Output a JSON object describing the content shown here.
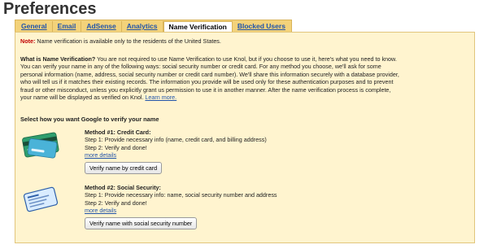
{
  "page": {
    "title": "Preferences"
  },
  "tabs": [
    {
      "label": "General",
      "active": false
    },
    {
      "label": "Email",
      "active": false
    },
    {
      "label": "AdSense",
      "active": false
    },
    {
      "label": "Analytics",
      "active": false
    },
    {
      "label": "Name Verification",
      "active": true
    },
    {
      "label": "Blocked Users",
      "active": false
    }
  ],
  "note": {
    "label": "Note:",
    "text": "Name verification is available only to the residents of the United States."
  },
  "about": {
    "heading": "What is Name Verification?",
    "line1": "You are not required to use Name Verification to use Knol, but if you choose to use it, here's what you need to know.",
    "line2": "You can verify your name in any of the following ways: social security number or credit card. For any method you choose, we'll ask for some",
    "line3": "personal information (name, address, social security number or credit card number). We'll share this information securely with a database provider,",
    "line4": "who will tell us if it matches their existing records. The information you provide will be used only for these authentication purposes and to prevent",
    "line5": "fraud or other misconduct, unless you explicitly grant us permission to use it in another manner. After the name verification process is complete,",
    "line6": "your name will be displayed as verified on Knol.",
    "learn_more": "Learn more."
  },
  "select_label": "Select how you want Google to verify your name",
  "methods": [
    {
      "title": "Method #1: Credit Card:",
      "step1": "Step 1: Provide necessary info (name, credit card, and billing address)",
      "step2": "Step 2: Verify and done!",
      "details": "more details",
      "button": "Verify name by credit card",
      "icon": "credit-card-icon"
    },
    {
      "title": "Method #2: Social Security:",
      "step1": "Step 1: Provide necessary info: name, social security number and address",
      "step2": "Step 2: Verify and done!",
      "details": "more details",
      "button": "Verify name with social security number",
      "icon": "social-security-card-icon"
    }
  ],
  "colors": {
    "panel_bg": "#fff4cf",
    "tab_bar": "#f3d27a",
    "link": "#2255aa",
    "note": "#c00000"
  }
}
